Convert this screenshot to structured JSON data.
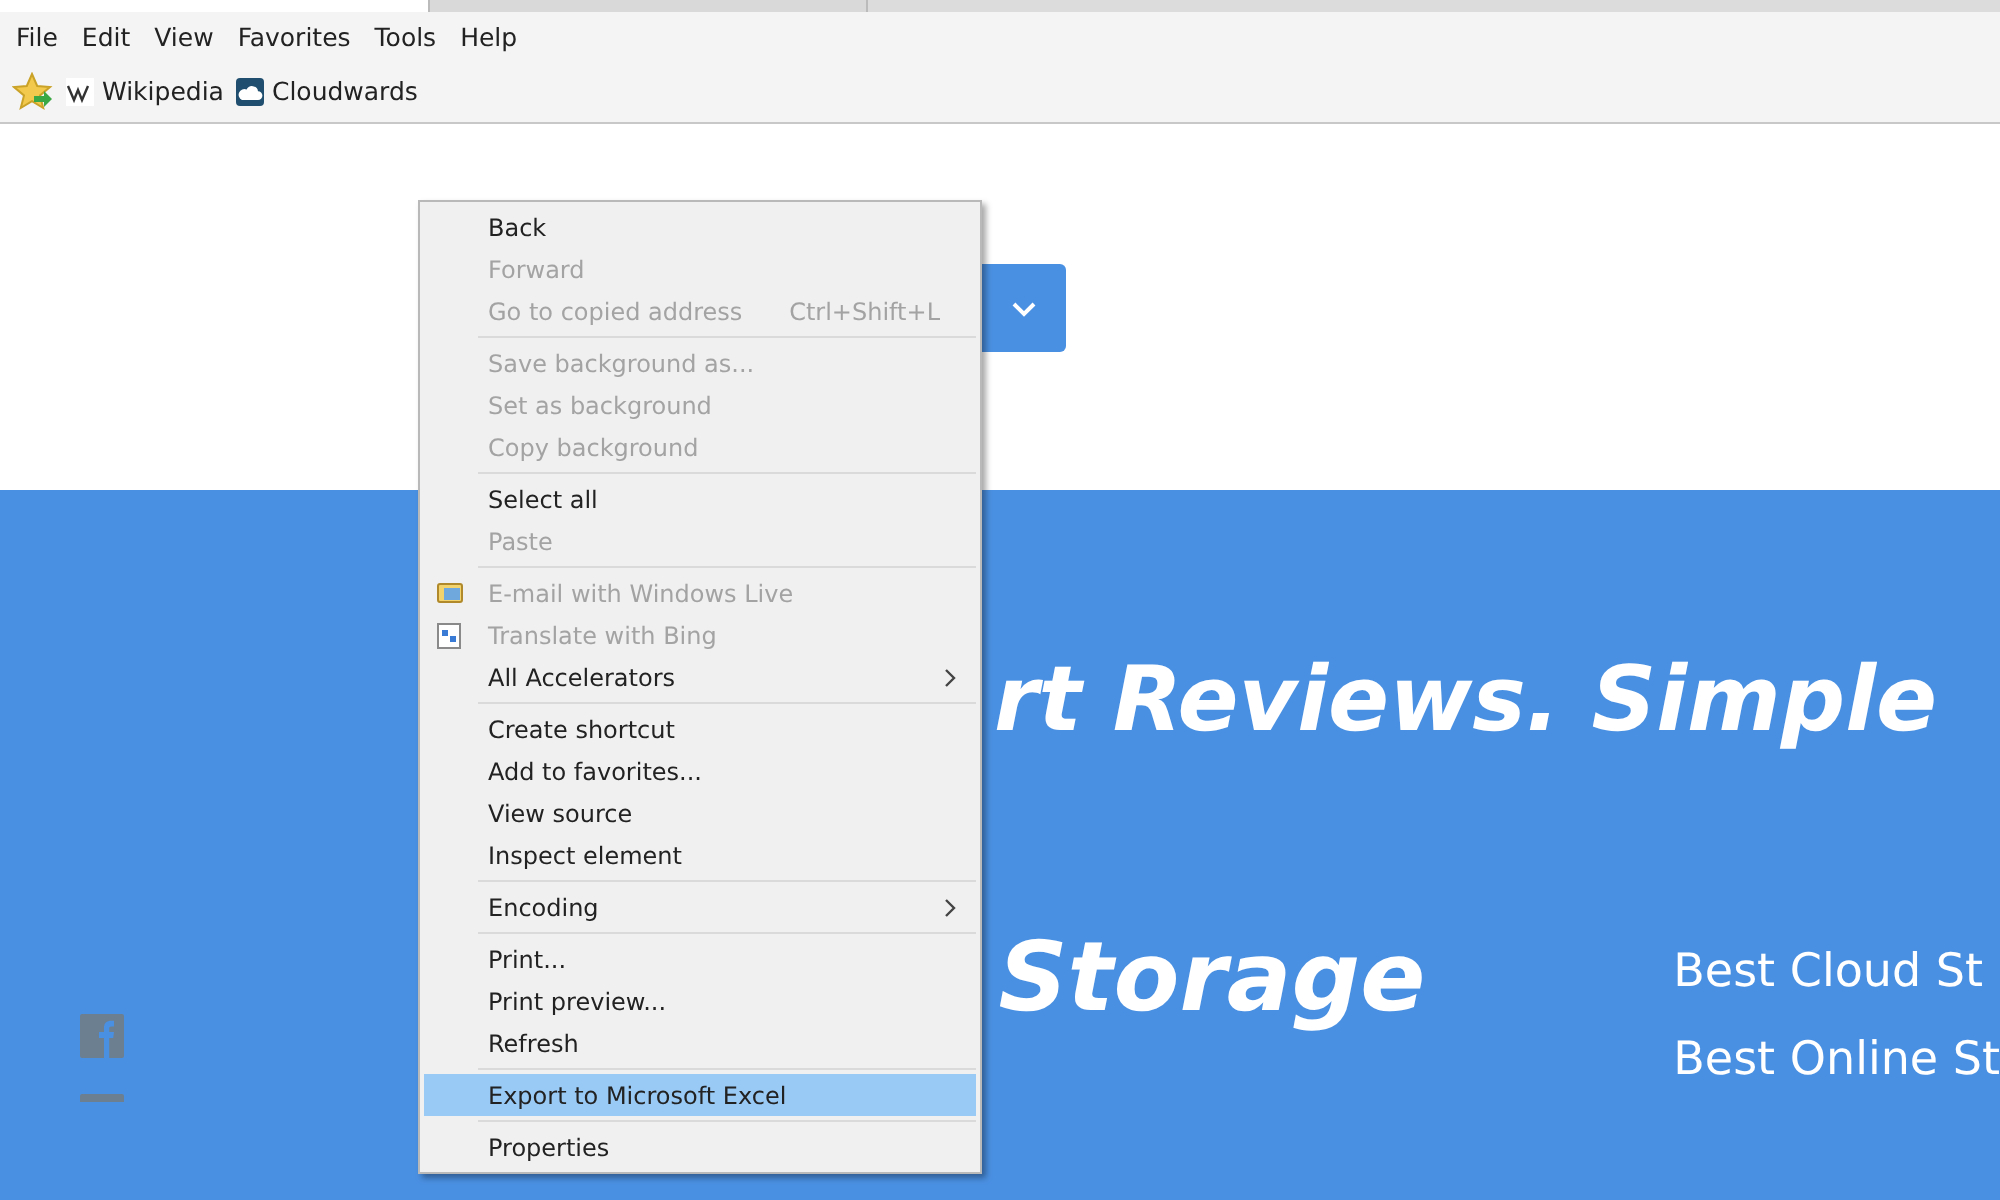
{
  "browser": {
    "tabs": [
      {
        "selected": true
      },
      {
        "selected": false
      }
    ],
    "menu_bar": [
      "File",
      "Edit",
      "View",
      "Favorites",
      "Tools",
      "Help"
    ],
    "favorites_bar": [
      {
        "label": "Wikipedia",
        "kind": "wiki"
      },
      {
        "label": "Cloudwards",
        "kind": "cloud"
      }
    ]
  },
  "page": {
    "hero_text": "rt Reviews. Simple",
    "heading": "Storage",
    "links": [
      "Best Cloud St",
      "Best Online St"
    ]
  },
  "context_menu": {
    "groups": [
      [
        {
          "label": "Back",
          "kind": "plain",
          "disabled": false,
          "selected": false
        },
        {
          "label": "Forward",
          "kind": "plain",
          "disabled": true,
          "selected": false
        },
        {
          "label": "Go to copied address",
          "kind": "plain",
          "shortcut": "Ctrl+Shift+L",
          "disabled": true,
          "selected": false
        }
      ],
      [
        {
          "label": "Save background as...",
          "kind": "plain",
          "disabled": true,
          "selected": false
        },
        {
          "label": "Set as background",
          "kind": "plain",
          "disabled": true,
          "selected": false
        },
        {
          "label": "Copy background",
          "kind": "plain",
          "disabled": true,
          "selected": false
        }
      ],
      [
        {
          "label": "Select all",
          "kind": "plain",
          "disabled": false,
          "selected": false
        },
        {
          "label": "Paste",
          "kind": "plain",
          "disabled": true,
          "selected": false
        }
      ],
      [
        {
          "label": "E-mail with Windows Live",
          "kind": "mail",
          "disabled": true,
          "selected": false
        },
        {
          "label": "Translate with Bing",
          "kind": "translate",
          "disabled": true,
          "selected": false
        },
        {
          "label": "All Accelerators",
          "kind": "submenu",
          "disabled": false,
          "selected": false
        }
      ],
      [
        {
          "label": "Create shortcut",
          "kind": "plain",
          "disabled": false,
          "selected": false
        },
        {
          "label": "Add to favorites...",
          "kind": "plain",
          "disabled": false,
          "selected": false
        },
        {
          "label": "View source",
          "kind": "plain",
          "disabled": false,
          "selected": false
        },
        {
          "label": "Inspect element",
          "kind": "plain",
          "disabled": false,
          "selected": false
        }
      ],
      [
        {
          "label": "Encoding",
          "kind": "submenu",
          "disabled": false,
          "selected": false
        }
      ],
      [
        {
          "label": "Print...",
          "kind": "plain",
          "disabled": false,
          "selected": false
        },
        {
          "label": "Print preview...",
          "kind": "plain",
          "disabled": false,
          "selected": false
        },
        {
          "label": "Refresh",
          "kind": "plain",
          "disabled": false,
          "selected": false
        }
      ],
      [
        {
          "label": "Export to Microsoft Excel",
          "kind": "plain",
          "disabled": false,
          "selected": true
        }
      ],
      [
        {
          "label": "Properties",
          "kind": "plain",
          "disabled": false,
          "selected": false
        }
      ]
    ]
  }
}
